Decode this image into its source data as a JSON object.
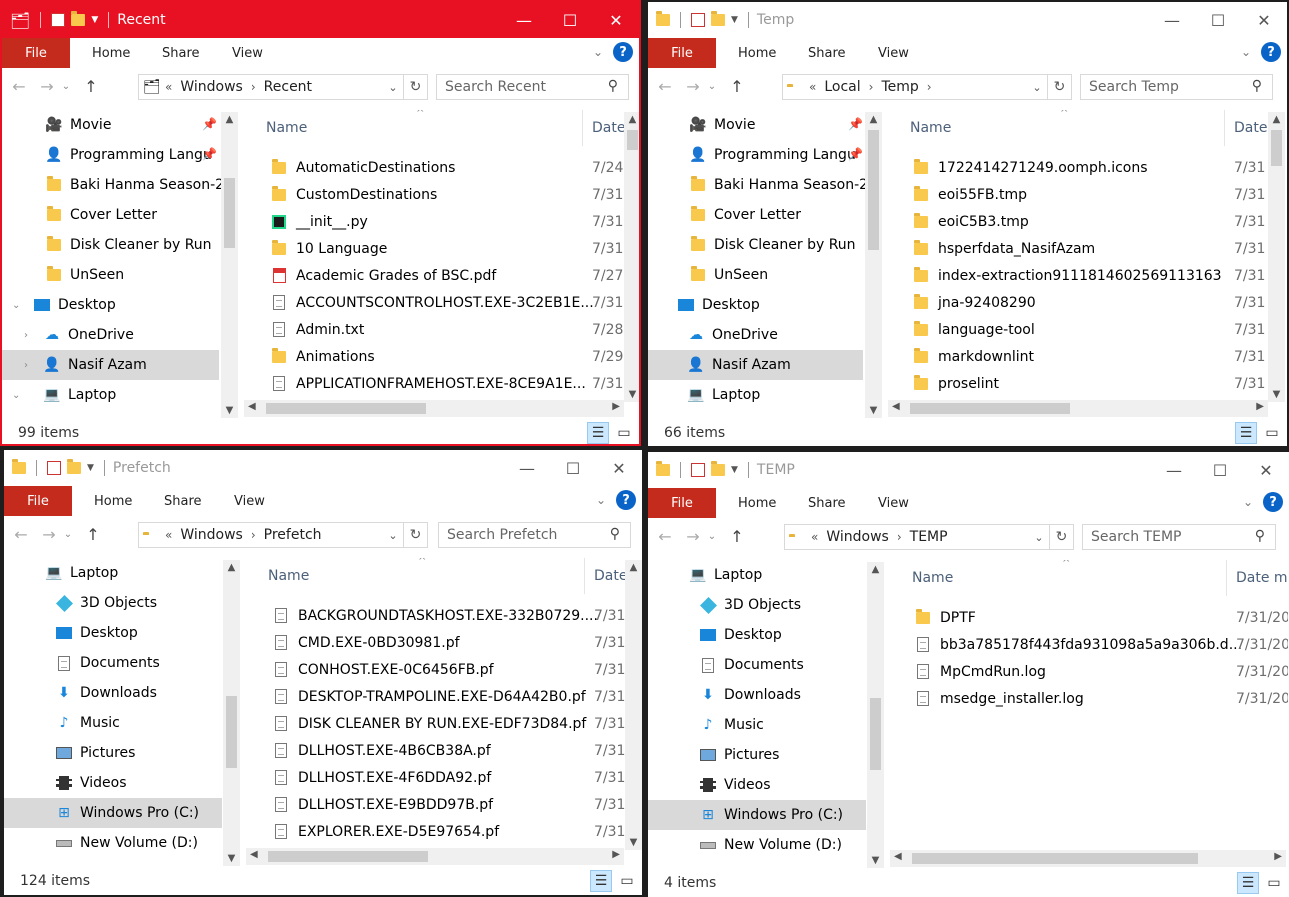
{
  "ribbon": {
    "file": "File",
    "home": "Home",
    "share": "Share",
    "view": "View"
  },
  "windows": [
    {
      "title": "Recent",
      "path": [
        "Windows",
        "Recent"
      ],
      "search_placeholder": "Search Recent",
      "nav_items": [
        {
          "label": "Movie",
          "icon": "camera-icon",
          "pinned": true
        },
        {
          "label": "Programming Langu",
          "icon": "person-icon",
          "pinned": true
        },
        {
          "label": "Baki Hanma Season-2",
          "icon": "folder-icon",
          "pinned": false
        },
        {
          "label": "Cover Letter",
          "icon": "folder-icon",
          "pinned": false
        },
        {
          "label": "Disk Cleaner by Run",
          "icon": "folder-icon",
          "pinned": false
        },
        {
          "label": "UnSeen",
          "icon": "folder-icon",
          "pinned": false
        },
        {
          "label": "Desktop",
          "icon": "desktop-icon",
          "expand": "open"
        },
        {
          "label": "OneDrive",
          "icon": "cloud-icon",
          "expand": "closed"
        },
        {
          "label": "Nasif Azam",
          "icon": "user-icon",
          "expand": "closed",
          "selected": true
        },
        {
          "label": "Laptop",
          "icon": "laptop-icon",
          "expand": "open"
        }
      ],
      "columns": {
        "name": "Name",
        "date": "Date"
      },
      "files": [
        {
          "name": "AutomaticDestinations",
          "date": "7/24",
          "icon": "folder-icon"
        },
        {
          "name": "CustomDestinations",
          "date": "7/31",
          "icon": "folder-icon"
        },
        {
          "name": "__init__.py",
          "date": "7/31",
          "icon": "pycharm-icon"
        },
        {
          "name": "10 Language",
          "date": "7/31",
          "icon": "shortcut-folder-icon"
        },
        {
          "name": "Academic Grades of BSC.pdf",
          "date": "7/27",
          "icon": "pdf-icon"
        },
        {
          "name": "ACCOUNTSCONTROLHOST.EXE-3C2EB1E...",
          "date": "7/31",
          "icon": "shortcut-icon"
        },
        {
          "name": "Admin.txt",
          "date": "7/28",
          "icon": "text-file-icon"
        },
        {
          "name": "Animations",
          "date": "7/29",
          "icon": "shortcut-folder-icon"
        },
        {
          "name": "APPLICATIONFRAMEHOST.EXE-8CE9A1E...",
          "date": "7/31",
          "icon": "shortcut-icon"
        }
      ],
      "status": "99 items"
    },
    {
      "title": "Temp",
      "path": [
        "Local",
        "Temp"
      ],
      "search_placeholder": "Search Temp",
      "nav_items": [
        {
          "label": "Movie",
          "icon": "camera-icon",
          "pinned": true
        },
        {
          "label": "Programming Langu",
          "icon": "person-icon",
          "pinned": true
        },
        {
          "label": "Baki Hanma Season-2",
          "icon": "folder-icon",
          "pinned": false
        },
        {
          "label": "Cover Letter",
          "icon": "folder-icon",
          "pinned": false
        },
        {
          "label": "Disk Cleaner by Run",
          "icon": "folder-icon",
          "pinned": false
        },
        {
          "label": "UnSeen",
          "icon": "folder-icon",
          "pinned": false
        },
        {
          "label": "Desktop",
          "icon": "desktop-icon"
        },
        {
          "label": "OneDrive",
          "icon": "cloud-icon"
        },
        {
          "label": "Nasif Azam",
          "icon": "user-icon",
          "selected": true
        },
        {
          "label": "Laptop",
          "icon": "laptop-icon"
        }
      ],
      "columns": {
        "name": "Name",
        "date": "Date"
      },
      "files": [
        {
          "name": "1722414271249.oomph.icons",
          "date": "7/31",
          "icon": "folder-icon"
        },
        {
          "name": "eoi55FB.tmp",
          "date": "7/31",
          "icon": "folder-icon"
        },
        {
          "name": "eoiC5B3.tmp",
          "date": "7/31",
          "icon": "folder-icon"
        },
        {
          "name": "hsperfdata_NasifAzam",
          "date": "7/31",
          "icon": "folder-icon"
        },
        {
          "name": "index-extraction9111814602569113163",
          "date": "7/31",
          "icon": "folder-icon"
        },
        {
          "name": "jna-92408290",
          "date": "7/31",
          "icon": "folder-icon"
        },
        {
          "name": "language-tool",
          "date": "7/31",
          "icon": "folder-icon"
        },
        {
          "name": "markdownlint",
          "date": "7/31",
          "icon": "folder-icon"
        },
        {
          "name": "proselint",
          "date": "7/31",
          "icon": "folder-icon"
        }
      ],
      "status": "66 items"
    },
    {
      "title": "Prefetch",
      "path": [
        "Windows",
        "Prefetch"
      ],
      "search_placeholder": "Search Prefetch",
      "nav_items": [
        {
          "label": "Laptop",
          "icon": "laptop-icon"
        },
        {
          "label": "3D Objects",
          "icon": "cube-icon"
        },
        {
          "label": "Desktop",
          "icon": "desktop-icon"
        },
        {
          "label": "Documents",
          "icon": "documents-icon"
        },
        {
          "label": "Downloads",
          "icon": "download-icon"
        },
        {
          "label": "Music",
          "icon": "music-icon"
        },
        {
          "label": "Pictures",
          "icon": "pictures-icon"
        },
        {
          "label": "Videos",
          "icon": "videos-icon"
        },
        {
          "label": "Windows Pro (C:)",
          "icon": "drive-icon",
          "selected": true
        },
        {
          "label": "New Volume (D:)",
          "icon": "drive-icon"
        }
      ],
      "columns": {
        "name": "Name",
        "date": "Date"
      },
      "files": [
        {
          "name": "BACKGROUNDTASKHOST.EXE-332B0729....",
          "date": "7/31",
          "icon": "file-icon"
        },
        {
          "name": "CMD.EXE-0BD30981.pf",
          "date": "7/31",
          "icon": "file-icon"
        },
        {
          "name": "CONHOST.EXE-0C6456FB.pf",
          "date": "7/31",
          "icon": "file-icon"
        },
        {
          "name": "DESKTOP-TRAMPOLINE.EXE-D64A42B0.pf",
          "date": "7/31",
          "icon": "file-icon"
        },
        {
          "name": "DISK CLEANER BY RUN.EXE-EDF73D84.pf",
          "date": "7/31",
          "icon": "file-icon"
        },
        {
          "name": "DLLHOST.EXE-4B6CB38A.pf",
          "date": "7/31",
          "icon": "file-icon"
        },
        {
          "name": "DLLHOST.EXE-4F6DDA92.pf",
          "date": "7/31",
          "icon": "file-icon"
        },
        {
          "name": "DLLHOST.EXE-E9BDD97B.pf",
          "date": "7/31",
          "icon": "file-icon"
        },
        {
          "name": "EXPLORER.EXE-D5E97654.pf",
          "date": "7/31",
          "icon": "file-icon"
        }
      ],
      "status": "124 items"
    },
    {
      "title": "TEMP",
      "path": [
        "Windows",
        "TEMP"
      ],
      "search_placeholder": "Search TEMP",
      "nav_items": [
        {
          "label": "Laptop",
          "icon": "laptop-icon"
        },
        {
          "label": "3D Objects",
          "icon": "cube-icon"
        },
        {
          "label": "Desktop",
          "icon": "desktop-icon"
        },
        {
          "label": "Documents",
          "icon": "documents-icon"
        },
        {
          "label": "Downloads",
          "icon": "download-icon"
        },
        {
          "label": "Music",
          "icon": "music-icon"
        },
        {
          "label": "Pictures",
          "icon": "pictures-icon"
        },
        {
          "label": "Videos",
          "icon": "videos-icon"
        },
        {
          "label": "Windows Pro (C:)",
          "icon": "drive-icon",
          "selected": true
        },
        {
          "label": "New Volume (D:)",
          "icon": "drive-icon"
        }
      ],
      "columns": {
        "name": "Name",
        "date": "Date m"
      },
      "files": [
        {
          "name": "DPTF",
          "date": "7/31/20",
          "icon": "folder-icon"
        },
        {
          "name": "bb3a785178f443fda931098a5a9a306b.d...",
          "date": "7/31/20",
          "icon": "file-icon"
        },
        {
          "name": "MpCmdRun.log",
          "date": "7/31/20",
          "icon": "text-file-icon"
        },
        {
          "name": "msedge_installer.log",
          "date": "7/31/20",
          "icon": "text-file-icon"
        }
      ],
      "status": "4 items"
    }
  ]
}
